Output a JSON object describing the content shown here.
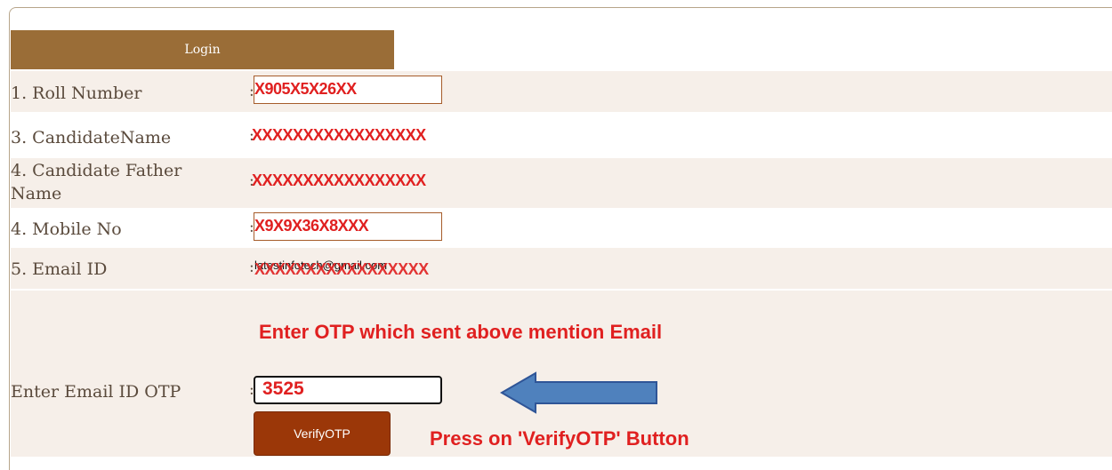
{
  "header": {
    "login_tab": "Login"
  },
  "form": {
    "roll_number": {
      "label": "1. Roll Number",
      "colon": ":",
      "value": "X905X5X26XX"
    },
    "candidate_name": {
      "label": "3. CandidateName",
      "colon": ":",
      "value": "XXXXXXXXXXXXXXXXX"
    },
    "father_name": {
      "label_line1": "4. Candidate Father",
      "label_line2": "Name",
      "colon": ":",
      "value": "XXXXXXXXXXXXXXXXX"
    },
    "mobile_no": {
      "label": "4. Mobile No",
      "colon": ":",
      "value": "X9X9X36X8XXX"
    },
    "email_id": {
      "label": "5. Email ID",
      "colon": ":",
      "value_under": "latestinfotech@gmail.com",
      "value": "XXXXXXXXXXXXXXXXX"
    },
    "email_otp": {
      "label": "Enter Email ID OTP",
      "colon": ":",
      "value": "3525"
    },
    "verify_button": "VerifyOTP"
  },
  "annotations": {
    "otp_note": "Enter OTP which sent above mention Email",
    "press_note": "Press on 'VerifyOTP' Button"
  },
  "colors": {
    "tab_brown": "#9a6d37",
    "row_shade": "#f6efe9",
    "button_brown": "#9b3708",
    "annotation_red": "#e02020",
    "arrow_blue": "#4f81bd"
  }
}
